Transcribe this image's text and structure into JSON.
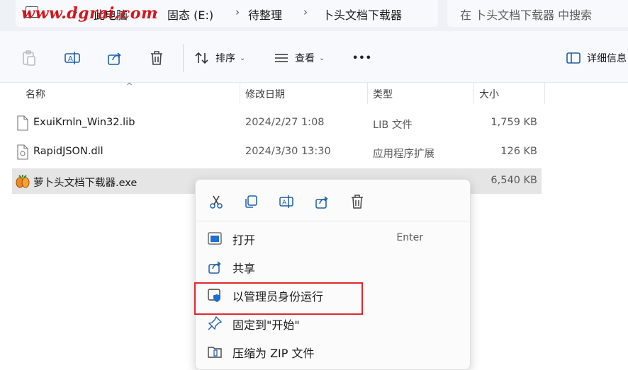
{
  "breadcrumb": {
    "items": [
      "此电脑",
      "固态 (E:)",
      "待整理",
      "卜头文档下载器"
    ],
    "watermark": "www.dgrai.com"
  },
  "search": {
    "placeholder": "在 卜头文档下载器 中搜索"
  },
  "toolbar": {
    "sort_label": "排序",
    "view_label": "查看",
    "more_label": "•••",
    "details_label": "详细信息"
  },
  "columns": {
    "name": "名称",
    "modified": "修改日期",
    "type": "类型",
    "size": "大小"
  },
  "files": [
    {
      "name": "ExuiKrnln_Win32.lib",
      "modified": "2024/2/27 1:08",
      "type": "LIB 文件",
      "size": "1,759 KB"
    },
    {
      "name": "RapidJSON.dll",
      "modified": "2024/3/30 13:30",
      "type": "应用程序扩展",
      "size": "126 KB"
    },
    {
      "name": "萝卜头文档下载器.exe",
      "modified": "",
      "type": "",
      "size": "6,540 KB"
    }
  ],
  "context_menu": {
    "items": [
      {
        "label": "打开",
        "accelerator": "Enter"
      },
      {
        "label": "共享"
      },
      {
        "label": "以管理员身份运行"
      },
      {
        "label": "固定到\"开始\""
      },
      {
        "label": "压缩为 ZIP 文件"
      }
    ]
  },
  "colors": {
    "accent": "#0067c0",
    "highlight_border": "#e0282e",
    "watermark": "#d6141d",
    "selected_row": "#e5e5e5"
  }
}
